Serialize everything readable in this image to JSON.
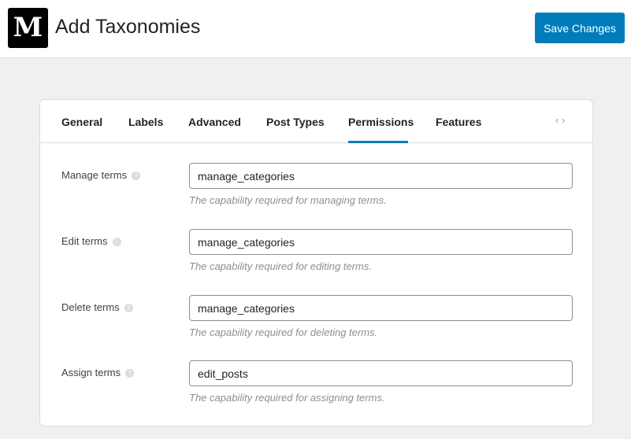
{
  "header": {
    "logo": "M",
    "title": "Add Taxonomies",
    "save_label": "Save Changes"
  },
  "tabs": [
    "General",
    "Labels",
    "Advanced",
    "Post Types",
    "Permissions",
    "Features"
  ],
  "fields": [
    {
      "label": "Manage terms",
      "value": "manage_categories",
      "description": "The capability required for managing terms."
    },
    {
      "label": "Edit terms",
      "value": "manage_categories",
      "description": "The capability required for editing terms."
    },
    {
      "label": "Delete terms",
      "value": "manage_categories",
      "description": "The capability required for deleting terms."
    },
    {
      "label": "Assign terms",
      "value": "edit_posts",
      "description": "The capability required for assigning terms."
    }
  ],
  "help_glyph": "?",
  "arrows": "‹ ›"
}
